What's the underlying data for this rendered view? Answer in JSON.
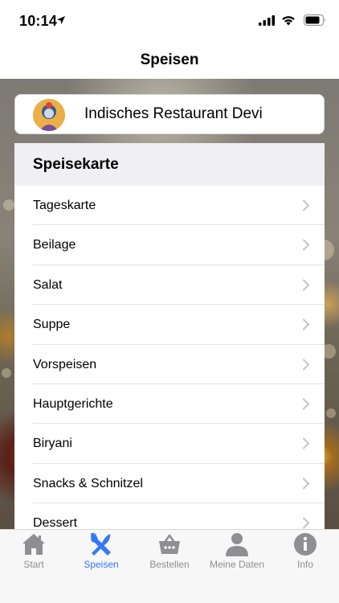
{
  "status": {
    "time": "10:14"
  },
  "nav": {
    "title": "Speisen"
  },
  "restaurant": {
    "name": "Indisches Restaurant Devi"
  },
  "menu": {
    "header": "Speisekarte",
    "items": [
      {
        "label": "Tageskarte"
      },
      {
        "label": "Beilage"
      },
      {
        "label": "Salat"
      },
      {
        "label": "Suppe"
      },
      {
        "label": "Vorspeisen"
      },
      {
        "label": "Hauptgerichte"
      },
      {
        "label": "Biryani"
      },
      {
        "label": "Snacks & Schnitzel"
      },
      {
        "label": "Dessert"
      }
    ]
  },
  "tabs": [
    {
      "label": "Start",
      "icon": "house-icon"
    },
    {
      "label": "Speisen",
      "icon": "utensils-icon",
      "active": true
    },
    {
      "label": "Bestellen",
      "icon": "basket-icon"
    },
    {
      "label": "Meine Daten",
      "icon": "person-icon"
    },
    {
      "label": "Info",
      "icon": "info-icon"
    }
  ],
  "colors": {
    "accent": "#3478f6",
    "inactive": "#8e8e93",
    "section_bg": "#efeff4"
  }
}
